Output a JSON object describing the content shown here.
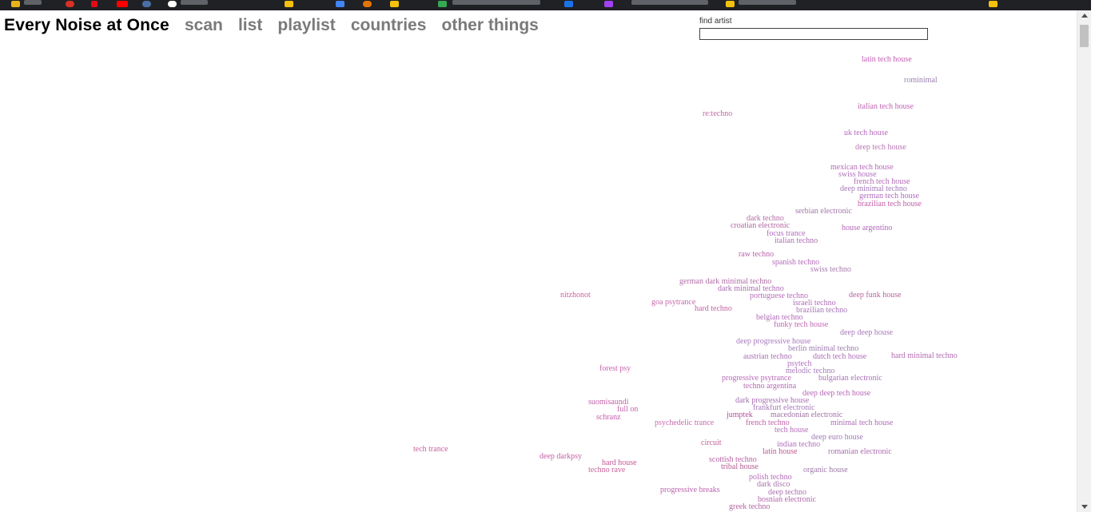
{
  "header": {
    "title": "Every Noise at Once",
    "nav": [
      {
        "label": "scan"
      },
      {
        "label": "list"
      },
      {
        "label": "playlist"
      },
      {
        "label": "countries"
      },
      {
        "label": "other things"
      }
    ]
  },
  "search": {
    "label": "find artist",
    "value": "",
    "placeholder": ""
  },
  "genres": [
    {
      "label": "latin tech house",
      "color": "#c55fb6"
    },
    {
      "label": "rominimal",
      "color": "#9c7fb0"
    },
    {
      "label": "italian tech house",
      "color": "#c064b4"
    },
    {
      "label": "re:techno",
      "color": "#c264a8"
    },
    {
      "label": "uk tech house",
      "color": "#b86abf"
    },
    {
      "label": "deep tech house",
      "color": "#b877b4"
    },
    {
      "label": "mexican tech house",
      "color": "#b769b7"
    },
    {
      "label": "swiss house",
      "color": "#b16fbd"
    },
    {
      "label": "french tech house",
      "color": "#b56cb5"
    },
    {
      "label": "deep minimal techno",
      "color": "#a578b8"
    },
    {
      "label": "german tech house",
      "color": "#b06cbd"
    },
    {
      "label": "brazilian tech house",
      "color": "#c15ea8"
    },
    {
      "label": "serbian electronic",
      "color": "#a477ad"
    },
    {
      "label": "dark techno",
      "color": "#b56caa"
    },
    {
      "label": "croatian electronic",
      "color": "#b1649f"
    },
    {
      "label": "house argentino",
      "color": "#b168b8"
    },
    {
      "label": "focus trance",
      "color": "#b06dbd"
    },
    {
      "label": "italian techno",
      "color": "#b06db1"
    },
    {
      "label": "raw techno",
      "color": "#ba63a9"
    },
    {
      "label": "spanish techno",
      "color": "#b56bbd"
    },
    {
      "label": "swiss techno",
      "color": "#a97aae"
    },
    {
      "label": "german dark minimal techno",
      "color": "#b26da7"
    },
    {
      "label": "dark minimal techno",
      "color": "#ab6eb1"
    },
    {
      "label": "nitzhonot",
      "color": "#cc5f9e"
    },
    {
      "label": "portuguese techno",
      "color": "#b96cbc"
    },
    {
      "label": "deep funk house",
      "color": "#b5649d"
    },
    {
      "label": "goa psytrance",
      "color": "#c567ac"
    },
    {
      "label": "israeli techno",
      "color": "#b16cba"
    },
    {
      "label": "hard techno",
      "color": "#c264a5"
    },
    {
      "label": "brazilian techno",
      "color": "#a675b7"
    },
    {
      "label": "belgian techno",
      "color": "#b26bbb"
    },
    {
      "label": "funky tech house",
      "color": "#c267b3"
    },
    {
      "label": "deep deep house",
      "color": "#a878bc"
    },
    {
      "label": "deep progressive house",
      "color": "#a87abd"
    },
    {
      "label": "berlin minimal techno",
      "color": "#9c7cae"
    },
    {
      "label": "austrian techno",
      "color": "#a873b5"
    },
    {
      "label": "dutch tech house",
      "color": "#af6cbc"
    },
    {
      "label": "hard minimal techno",
      "color": "#b26bb0"
    },
    {
      "label": "psytech",
      "color": "#b46ec2"
    },
    {
      "label": "forest psy",
      "color": "#c864b1"
    },
    {
      "label": "melodic techno",
      "color": "#a87bba"
    },
    {
      "label": "progressive psytrance",
      "color": "#b96ab9"
    },
    {
      "label": "bulgarian electronic",
      "color": "#ab73b8"
    },
    {
      "label": "techno argentina",
      "color": "#b669b2"
    },
    {
      "label": "deep deep tech house",
      "color": "#b767b8"
    },
    {
      "label": "suomisaundi",
      "color": "#c35fa7"
    },
    {
      "label": "dark progressive house",
      "color": "#a76eb2"
    },
    {
      "label": "full on",
      "color": "#c963b2"
    },
    {
      "label": "frankfurt electronic",
      "color": "#a57aba"
    },
    {
      "label": "jumptek",
      "color": "#b2519a"
    },
    {
      "label": "macedonian electronic",
      "color": "#a171a5"
    },
    {
      "label": "schranz",
      "color": "#c45da9"
    },
    {
      "label": "psychedelic trance",
      "color": "#c66aaf"
    },
    {
      "label": "french techno",
      "color": "#c262a8"
    },
    {
      "label": "minimal tech house",
      "color": "#ac6db6"
    },
    {
      "label": "tech house",
      "color": "#b86cbb"
    },
    {
      "label": "deep euro house",
      "color": "#a07bb3"
    },
    {
      "label": "circuit",
      "color": "#c25e9c"
    },
    {
      "label": "indian techno",
      "color": "#b36dbf"
    },
    {
      "label": "tech trance",
      "color": "#c7619f"
    },
    {
      "label": "latin house",
      "color": "#c15795"
    },
    {
      "label": "romanian electronic",
      "color": "#ac6dae"
    },
    {
      "label": "deep darkpsy",
      "color": "#c55fa2"
    },
    {
      "label": "scottish techno",
      "color": "#b962a3"
    },
    {
      "label": "hard house",
      "color": "#c65394"
    },
    {
      "label": "tribal house",
      "color": "#b35990"
    },
    {
      "label": "organic house",
      "color": "#9e7aa9"
    },
    {
      "label": "techno rave",
      "color": "#c86399"
    },
    {
      "label": "polish techno",
      "color": "#b36bb8"
    },
    {
      "label": "dark disco",
      "color": "#a873ad"
    },
    {
      "label": "progressive breaks",
      "color": "#ba63ae"
    },
    {
      "label": "deep techno",
      "color": "#ab70ad"
    },
    {
      "label": "bosnian electronic",
      "color": "#b265ac"
    },
    {
      "label": "greek techno",
      "color": "#b267a2"
    }
  ]
}
